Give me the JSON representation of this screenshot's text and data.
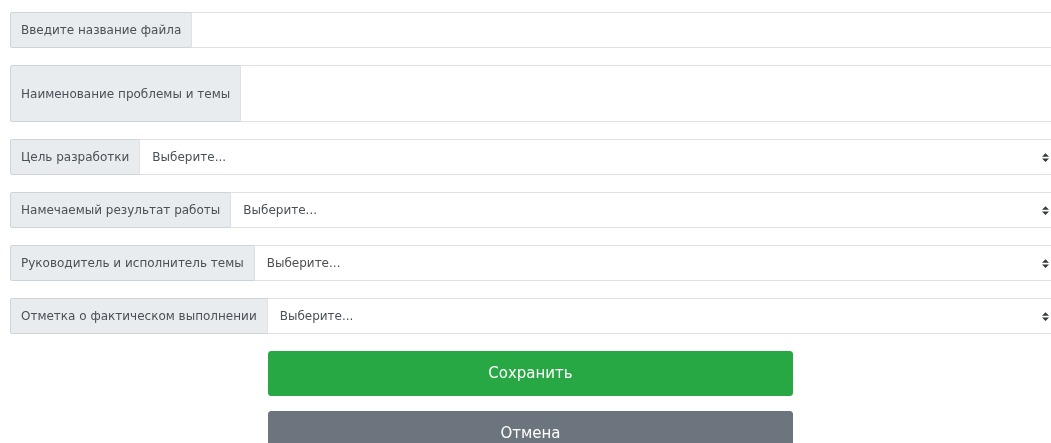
{
  "fields": [
    {
      "kind": "input",
      "label": "Введите название файла"
    },
    {
      "kind": "textarea",
      "label": "Наименование проблемы и темы"
    },
    {
      "kind": "select",
      "label": "Цель разработки",
      "value": "Выберите..."
    },
    {
      "kind": "select",
      "label": "Намечаемый результат работы",
      "value": "Выберите..."
    },
    {
      "kind": "select",
      "label": "Руководитель и исполнитель темы",
      "value": "Выберите..."
    },
    {
      "kind": "select",
      "label": "Отметка о фактическом выполнении",
      "value": "Выберите..."
    }
  ],
  "buttons": [
    {
      "kind": "primary",
      "label": "Сохранить"
    },
    {
      "kind": "secondary",
      "label": "Отмена"
    }
  ]
}
